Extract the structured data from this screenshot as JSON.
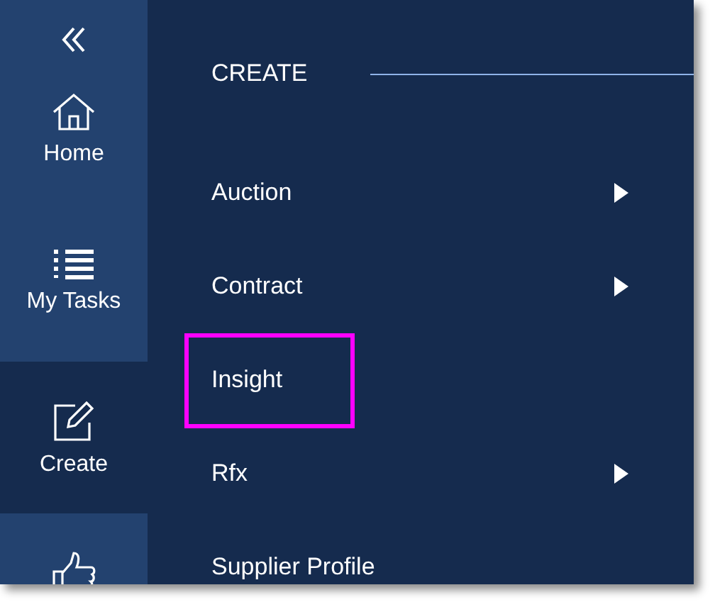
{
  "sidebar": {
    "items": [
      {
        "label": "Home",
        "selected": false
      },
      {
        "label": "My Tasks",
        "selected": false
      },
      {
        "label": "Create",
        "selected": true
      },
      {
        "selected": false
      }
    ]
  },
  "menu": {
    "title": "CREATE",
    "items": [
      {
        "label": "Auction",
        "submenu": true,
        "highlighted": false
      },
      {
        "label": "Contract",
        "submenu": true,
        "highlighted": false
      },
      {
        "label": "Insight",
        "submenu": false,
        "highlighted": true
      },
      {
        "label": "Rfx",
        "submenu": true,
        "highlighted": false
      },
      {
        "label": "Supplier Profile",
        "submenu": false,
        "highlighted": false
      }
    ]
  }
}
